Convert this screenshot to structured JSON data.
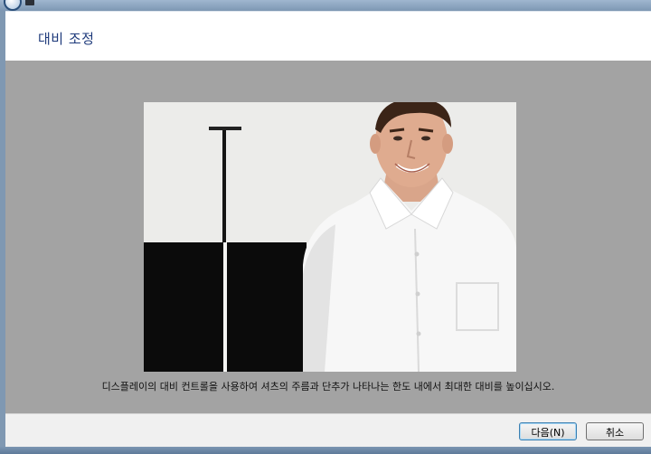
{
  "window": {
    "title": "대비 조정"
  },
  "content": {
    "instruction": "디스플레이의 대비 컨트롤을 사용하여 셔츠의 주름과 단추가 나타나는 한도 내에서 최대한 대비를 높이십시오."
  },
  "buttons": {
    "next_label": "다음(N)",
    "cancel_label": "취소"
  },
  "icons": {
    "photo": "man-in-white-shirt-calibration-image"
  },
  "colors": {
    "title_text": "#1e3a7b",
    "content_background": "#a3a3a3",
    "footer_background": "#f0f0f0"
  }
}
